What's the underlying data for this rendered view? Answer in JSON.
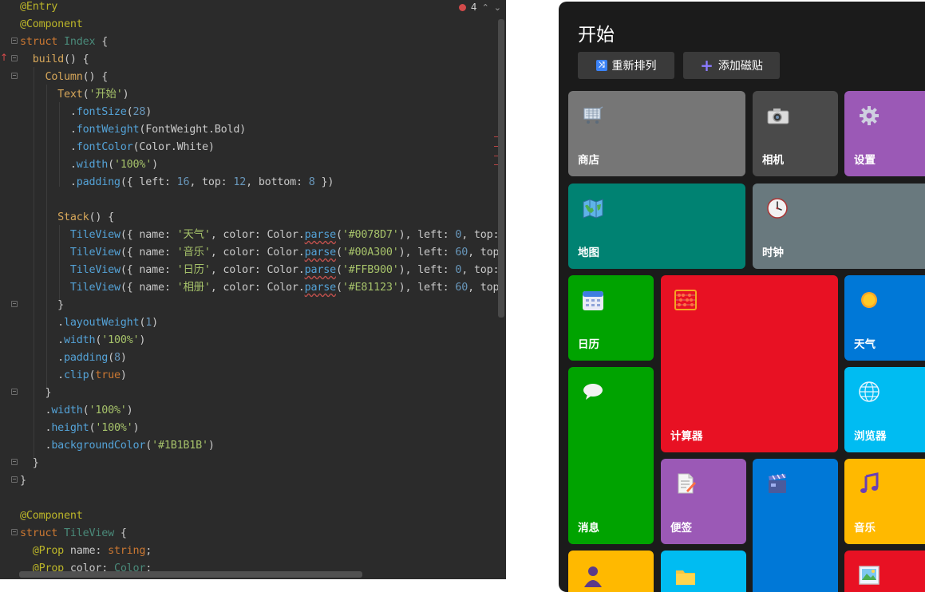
{
  "editor": {
    "error_count": "4",
    "lines": [
      [
        [
          "tk-dec",
          "@Entry"
        ]
      ],
      [
        [
          "tk-dec",
          "@Component"
        ]
      ],
      [
        [
          "tk-kw",
          "struct "
        ],
        [
          "tk-cls2",
          "Index "
        ],
        [
          "tk-pl",
          "{"
        ]
      ],
      [
        [
          "tk-pl",
          "  "
        ],
        [
          "tk-fn",
          "build"
        ],
        [
          "tk-pl",
          "() {"
        ]
      ],
      [
        [
          "tk-pl",
          "    "
        ],
        [
          "tk-fn",
          "Column"
        ],
        [
          "tk-pl",
          "() {"
        ]
      ],
      [
        [
          "tk-pl",
          "      "
        ],
        [
          "tk-fn",
          "Text"
        ],
        [
          "tk-pl",
          "("
        ],
        [
          "tk-str",
          "'开始'"
        ],
        [
          "tk-pl",
          ")"
        ]
      ],
      [
        [
          "tk-pl",
          "        ."
        ],
        [
          "tk-mth",
          "fontSize"
        ],
        [
          "tk-pl",
          "("
        ],
        [
          "tk-num",
          "28"
        ],
        [
          "tk-pl",
          ")"
        ]
      ],
      [
        [
          "tk-pl",
          "        ."
        ],
        [
          "tk-mth",
          "fontWeight"
        ],
        [
          "tk-pl",
          "(FontWeight.Bold)"
        ]
      ],
      [
        [
          "tk-pl",
          "        ."
        ],
        [
          "tk-mth",
          "fontColor"
        ],
        [
          "tk-pl",
          "(Color.White)"
        ]
      ],
      [
        [
          "tk-pl",
          "        ."
        ],
        [
          "tk-mth",
          "width"
        ],
        [
          "tk-pl",
          "("
        ],
        [
          "tk-str",
          "'100%'"
        ],
        [
          "tk-pl",
          ")"
        ]
      ],
      [
        [
          "tk-pl",
          "        ."
        ],
        [
          "tk-mth",
          "padding"
        ],
        [
          "tk-pl",
          "({ left: "
        ],
        [
          "tk-num",
          "16"
        ],
        [
          "tk-pl",
          ", top: "
        ],
        [
          "tk-num",
          "12"
        ],
        [
          "tk-pl",
          ", bottom: "
        ],
        [
          "tk-num",
          "8"
        ],
        [
          "tk-pl",
          " })"
        ]
      ],
      [
        [
          "tk-pl",
          ""
        ]
      ],
      [
        [
          "tk-pl",
          "      "
        ],
        [
          "tk-fn",
          "Stack"
        ],
        [
          "tk-pl",
          "() {"
        ]
      ],
      [
        [
          "tk-pl",
          "        "
        ],
        [
          "tk-mth",
          "TileView"
        ],
        [
          "tk-pl",
          "({ name: "
        ],
        [
          "tk-str",
          "'天气'"
        ],
        [
          "tk-pl",
          ", color: Color."
        ],
        [
          "tk-mth tk-und",
          "parse"
        ],
        [
          "tk-pl",
          "("
        ],
        [
          "tk-str",
          "'#0078D7'"
        ],
        [
          "tk-pl",
          "), left: "
        ],
        [
          "tk-num",
          "0"
        ],
        [
          "tk-pl",
          ", top:"
        ]
      ],
      [
        [
          "tk-pl",
          "        "
        ],
        [
          "tk-mth",
          "TileView"
        ],
        [
          "tk-pl",
          "({ name: "
        ],
        [
          "tk-str",
          "'音乐'"
        ],
        [
          "tk-pl",
          ", color: Color."
        ],
        [
          "tk-mth tk-und",
          "parse"
        ],
        [
          "tk-pl",
          "("
        ],
        [
          "tk-str",
          "'#00A300'"
        ],
        [
          "tk-pl",
          "), left: "
        ],
        [
          "tk-num",
          "60"
        ],
        [
          "tk-pl",
          ", top"
        ]
      ],
      [
        [
          "tk-pl",
          "        "
        ],
        [
          "tk-mth",
          "TileView"
        ],
        [
          "tk-pl",
          "({ name: "
        ],
        [
          "tk-str",
          "'日历'"
        ],
        [
          "tk-pl",
          ", color: Color."
        ],
        [
          "tk-mth tk-und",
          "parse"
        ],
        [
          "tk-pl",
          "("
        ],
        [
          "tk-str",
          "'#FFB900'"
        ],
        [
          "tk-pl",
          "), left: "
        ],
        [
          "tk-num",
          "0"
        ],
        [
          "tk-pl",
          ", top:"
        ]
      ],
      [
        [
          "tk-pl",
          "        "
        ],
        [
          "tk-mth",
          "TileView"
        ],
        [
          "tk-pl",
          "({ name: "
        ],
        [
          "tk-str",
          "'相册'"
        ],
        [
          "tk-pl",
          ", color: Color."
        ],
        [
          "tk-mth tk-und",
          "parse"
        ],
        [
          "tk-pl",
          "("
        ],
        [
          "tk-str",
          "'#E81123'"
        ],
        [
          "tk-pl",
          "), left: "
        ],
        [
          "tk-num",
          "60"
        ],
        [
          "tk-pl",
          ", top"
        ]
      ],
      [
        [
          "tk-pl",
          "      }"
        ]
      ],
      [
        [
          "tk-pl",
          "      ."
        ],
        [
          "tk-mth",
          "layoutWeight"
        ],
        [
          "tk-pl",
          "("
        ],
        [
          "tk-num",
          "1"
        ],
        [
          "tk-pl",
          ")"
        ]
      ],
      [
        [
          "tk-pl",
          "      ."
        ],
        [
          "tk-mth",
          "width"
        ],
        [
          "tk-pl",
          "("
        ],
        [
          "tk-str",
          "'100%'"
        ],
        [
          "tk-pl",
          ")"
        ]
      ],
      [
        [
          "tk-pl",
          "      ."
        ],
        [
          "tk-mth",
          "padding"
        ],
        [
          "tk-pl",
          "("
        ],
        [
          "tk-num",
          "8"
        ],
        [
          "tk-pl",
          ")"
        ]
      ],
      [
        [
          "tk-pl",
          "      ."
        ],
        [
          "tk-mth",
          "clip"
        ],
        [
          "tk-pl",
          "("
        ],
        [
          "tk-kw",
          "true"
        ],
        [
          "tk-pl",
          ")"
        ]
      ],
      [
        [
          "tk-pl",
          "    }"
        ]
      ],
      [
        [
          "tk-pl",
          "    ."
        ],
        [
          "tk-mth",
          "width"
        ],
        [
          "tk-pl",
          "("
        ],
        [
          "tk-str",
          "'100%'"
        ],
        [
          "tk-pl",
          ")"
        ]
      ],
      [
        [
          "tk-pl",
          "    ."
        ],
        [
          "tk-mth",
          "height"
        ],
        [
          "tk-pl",
          "("
        ],
        [
          "tk-str",
          "'100%'"
        ],
        [
          "tk-pl",
          ")"
        ]
      ],
      [
        [
          "tk-pl",
          "    ."
        ],
        [
          "tk-mth",
          "backgroundColor"
        ],
        [
          "tk-pl",
          "("
        ],
        [
          "tk-str",
          "'#1B1B1B'"
        ],
        [
          "tk-pl",
          ")"
        ]
      ],
      [
        [
          "tk-pl",
          "  }"
        ]
      ],
      [
        [
          "tk-pl",
          "}"
        ]
      ],
      [
        [
          "tk-pl",
          ""
        ]
      ],
      [
        [
          "tk-dec",
          "@Component"
        ]
      ],
      [
        [
          "tk-kw",
          "struct "
        ],
        [
          "tk-cls2",
          "TileView "
        ],
        [
          "tk-pl",
          "{"
        ]
      ],
      [
        [
          "tk-pl",
          "  "
        ],
        [
          "tk-dec",
          "@Prop "
        ],
        [
          "tk-pl",
          "name: "
        ],
        [
          "tk-kw",
          "string"
        ],
        [
          "tk-pl",
          ";"
        ]
      ],
      [
        [
          "tk-pl",
          "  "
        ],
        [
          "tk-dec",
          "@Prop "
        ],
        [
          "tk-pl",
          "color: "
        ],
        [
          "tk-cls2",
          "Color"
        ],
        [
          "tk-pl",
          ";"
        ]
      ]
    ]
  },
  "preview": {
    "title": "开始",
    "buttons": {
      "rearrange": "重新排列",
      "add_tile": "添加磁贴"
    },
    "tiles": [
      {
        "id": "store",
        "label": "商店",
        "color": "#767676",
        "icon": "cart-icon"
      },
      {
        "id": "camera",
        "label": "相机",
        "color": "#4a4a4a",
        "icon": "camera-icon"
      },
      {
        "id": "settings",
        "label": "设置",
        "color": "#9b59b6",
        "icon": "gear-icon"
      },
      {
        "id": "maps",
        "label": "地图",
        "color": "#008272",
        "icon": "map-icon"
      },
      {
        "id": "clock",
        "label": "时钟",
        "color": "#69797e",
        "icon": "clock-icon"
      },
      {
        "id": "calendar",
        "label": "日历",
        "color": "#00a300",
        "icon": "calendar-icon"
      },
      {
        "id": "calculator",
        "label": "计算器",
        "color": "#e81123",
        "icon": "abacus-icon"
      },
      {
        "id": "weather",
        "label": "天气",
        "color": "#0078d7",
        "icon": "sun-icon"
      },
      {
        "id": "messages",
        "label": "消息",
        "color": "#00a300",
        "icon": "chat-bubble-icon"
      },
      {
        "id": "browser",
        "label": "浏览器",
        "color": "#00bcf2",
        "icon": "globe-icon"
      },
      {
        "id": "notes",
        "label": "便签",
        "color": "#9b59b6",
        "icon": "notepad-icon"
      },
      {
        "id": "video",
        "label": "",
        "color": "#0078d7",
        "icon": "clapperboard-icon"
      },
      {
        "id": "music",
        "label": "音乐",
        "color": "#ffb900",
        "icon": "music-note-icon"
      },
      {
        "id": "people",
        "label": "",
        "color": "#ffb900",
        "icon": "person-icon"
      },
      {
        "id": "files",
        "label": "",
        "color": "#00bcf2",
        "icon": "folder-icon"
      },
      {
        "id": "photos",
        "label": "",
        "color": "#e81123",
        "icon": "picture-icon"
      }
    ]
  }
}
